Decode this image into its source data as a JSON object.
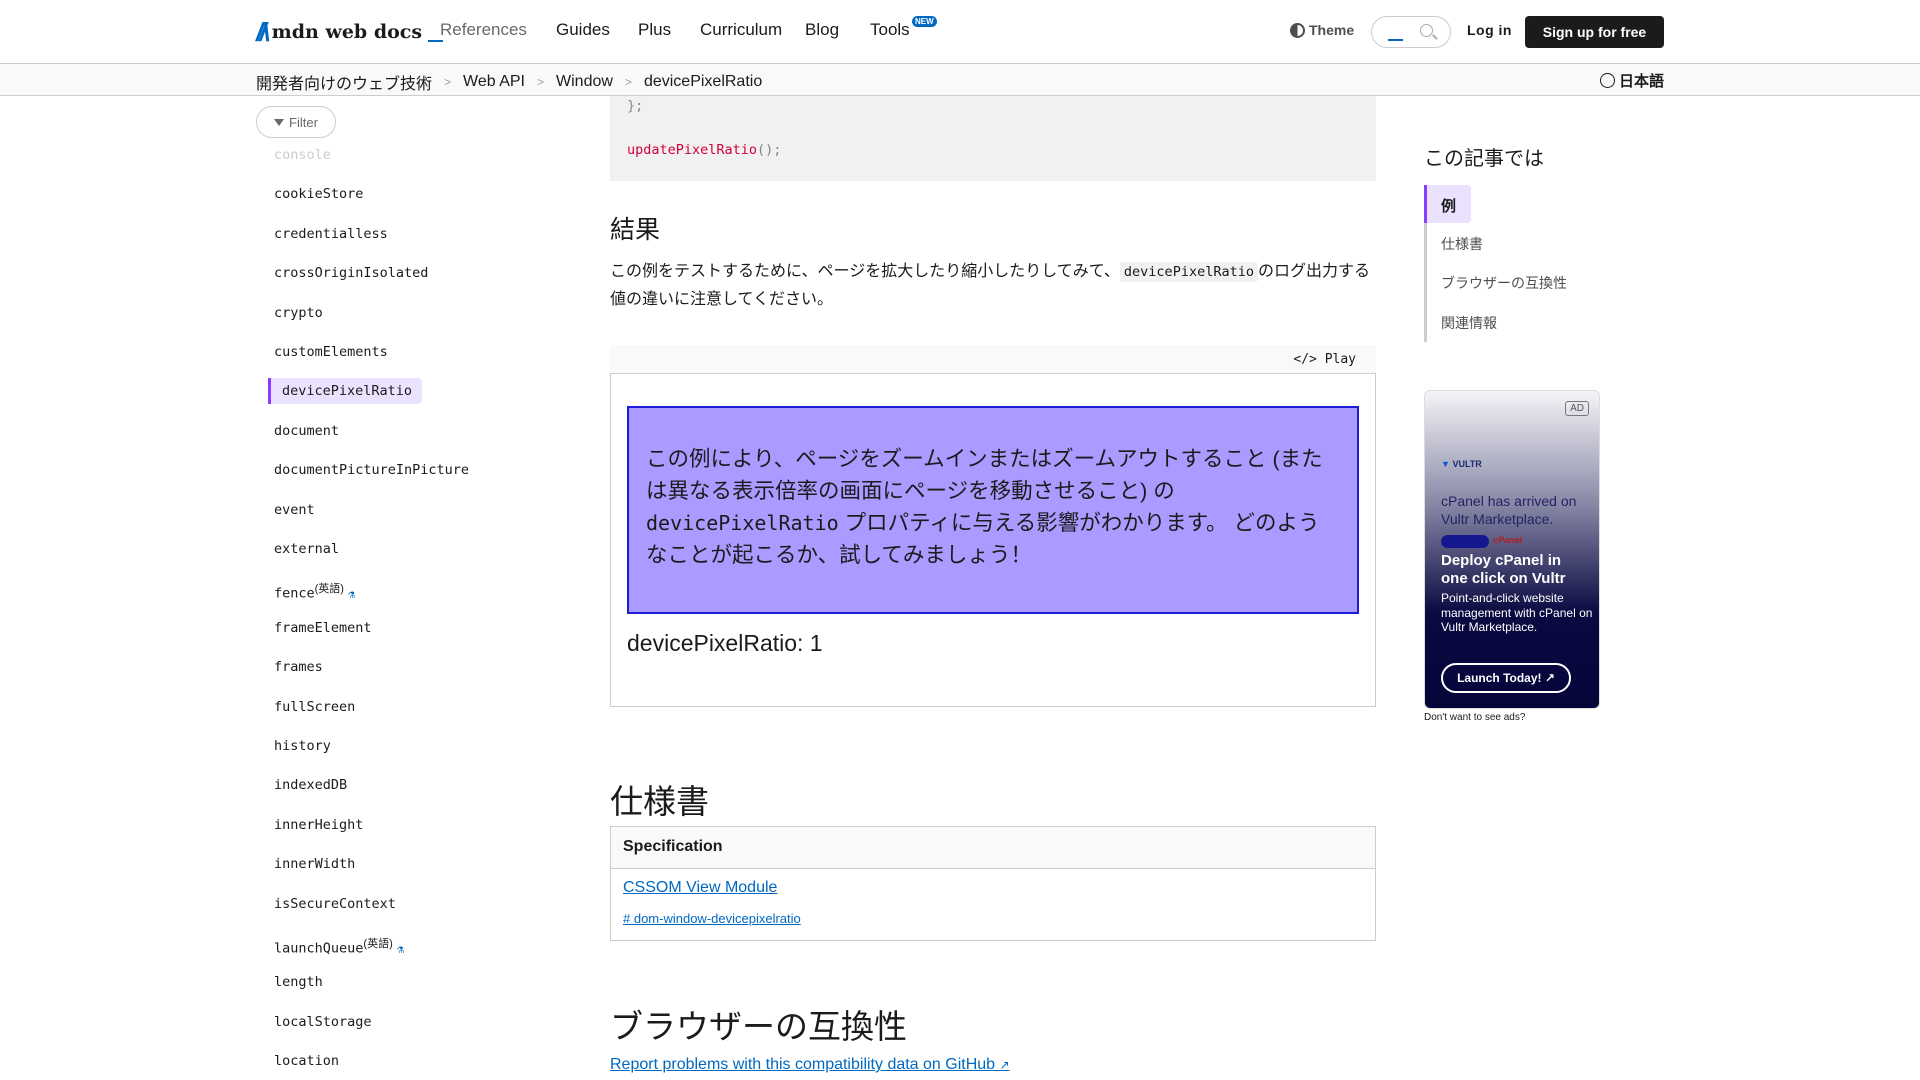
{
  "header": {
    "logo_text": "mdn web docs",
    "nav": [
      {
        "label": "References"
      },
      {
        "label": "Guides"
      },
      {
        "label": "Plus"
      },
      {
        "label": "Curriculum"
      },
      {
        "label": "Blog"
      },
      {
        "label": "Tools",
        "badge": "NEW"
      }
    ],
    "theme_label": "Theme",
    "login_label": "Log in",
    "signup_label": "Sign up for free"
  },
  "breadcrumb": [
    "開発者向けのウェブ技術",
    "Web API",
    "Window",
    "devicePixelRatio"
  ],
  "language": "日本語",
  "sidebar": {
    "filter_label": "Filter",
    "items": [
      {
        "label": "console"
      },
      {
        "label": "cookieStore"
      },
      {
        "label": "credentialless"
      },
      {
        "label": "crossOriginIsolated"
      },
      {
        "label": "crypto"
      },
      {
        "label": "customElements"
      },
      {
        "label": "devicePixelRatio"
      },
      {
        "label": "document"
      },
      {
        "label": "documentPictureInPicture"
      },
      {
        "label": "event"
      },
      {
        "label": "external"
      },
      {
        "label": "fence",
        "note": "(英語)"
      },
      {
        "label": "frameElement"
      },
      {
        "label": "frames"
      },
      {
        "label": "fullScreen"
      },
      {
        "label": "history"
      },
      {
        "label": "indexedDB"
      },
      {
        "label": "innerHeight"
      },
      {
        "label": "innerWidth"
      },
      {
        "label": "isSecureContext"
      },
      {
        "label": "launchQueue",
        "note": "(英語)"
      },
      {
        "label": "length"
      },
      {
        "label": "localStorage"
      },
      {
        "label": "location"
      }
    ]
  },
  "main": {
    "code_line1": "};",
    "code_line2_fn": "updatePixelRatio",
    "code_line2_rest": "();",
    "result_heading": "結果",
    "result_para_before": "この例をテストするために、ページを拡大したり縮小したりしてみて、",
    "result_para_code": "devicePixelRatio",
    "result_para_after": "のログ出力する値の違いに注意してください。",
    "play_label": "Play",
    "demo_text_1": "この例により、ページをズームインまたはズームアウトすること (または異なる表示倍率の画面にページを移動させること) の",
    "demo_code": "devicePixelRatio",
    "demo_text_2": " プロパティに与える影響がわかります。 どのようなことが起こるか、試してみましょう！",
    "dpr_output": "devicePixelRatio: 1",
    "spec_heading": "仕様書",
    "spec_table_header": "Specification",
    "spec_link": "CSSOM View Module",
    "spec_anchor": "# dom-window-devicepixelratio",
    "compat_heading": "ブラウザーの互換性",
    "report_link": "Report problems with this compatibility data on GitHub"
  },
  "toc": {
    "title": "この記事では",
    "items": [
      "例",
      "仕様書",
      "ブラウザーの互換性",
      "関連情報"
    ]
  },
  "ad": {
    "tag": "AD",
    "brand": "VULTR",
    "headline_faded": "cPanel has arrived on Vultr Marketplace.",
    "cpanel": "cPanel",
    "title": "Deploy cPanel in one click on Vultr",
    "description": "Point-and-click website management with cPanel on Vultr Marketplace.",
    "cta": "Launch Today!",
    "no_ads": "Don't want to see ads?"
  },
  "colors": {
    "accent": "#0069c2",
    "active_bg": "#ebe2ff",
    "active_border": "#8b3dff",
    "demo_bg": "#a99bff",
    "demo_border": "#1d1dd6"
  }
}
